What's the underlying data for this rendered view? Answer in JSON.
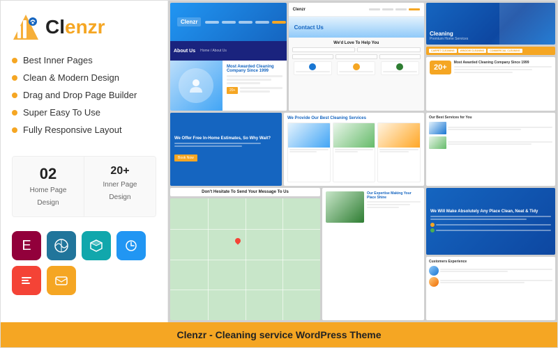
{
  "app": {
    "title": "Clenzr - Cleaning service WordPress Theme"
  },
  "logo": {
    "text_part1": "Cl",
    "text_part2": "enzr",
    "full": "Clenzr"
  },
  "features": [
    "Best Inner Pages",
    "Clean & Modern Design",
    "Drag and Drop Page Builder",
    "Super Easy To Use",
    "Fully Responsive Layout"
  ],
  "stats": [
    {
      "number": "02",
      "label1": "Home Page",
      "label2": "Design"
    },
    {
      "number": "20+",
      "label1": "Inner Page",
      "label2": "Design"
    }
  ],
  "icons": [
    {
      "name": "elementor",
      "symbol": "E",
      "class": "icon-elementor"
    },
    {
      "name": "wordpress",
      "symbol": "W",
      "class": "icon-wp"
    },
    {
      "name": "codepen",
      "symbol": "◆",
      "class": "icon-box"
    },
    {
      "name": "update",
      "symbol": "↺",
      "class": "icon-update"
    },
    {
      "name": "elementorkit",
      "symbol": "≡",
      "class": "icon-ek"
    },
    {
      "name": "mailchimp",
      "symbol": "✉",
      "class": "icon-mail"
    }
  ],
  "previews": {
    "about_us": "About Us",
    "contact_us": "Contact Us",
    "help_title": "We'd Love To Help You",
    "provide_title": "We Provide Our Best Cleaning Services",
    "free_estimate": "We Offer Free In-Home Estimates, So Why Wait?",
    "dont_hesitate": "Don't Hesitate To Send Your Message To Us",
    "expertise_title": "Our Expertise Making Your Place Shine",
    "awarded_title": "Most Awarded Cleaning Company Since 1999",
    "awarded_number": "20+",
    "best_services": "Our Best Services for You",
    "customers": "Customers Experience",
    "make_absolutely": "We Will Make Absolutely Any Place Clean, Neat & Tidy",
    "cleaning_label": "Cleaning",
    "categories": [
      "CARPET CLEANING",
      "WINDOW CLEANING",
      "COMMERCIAL CLEANING"
    ]
  },
  "footer": {
    "text": "Clenzr - Cleaning service WordPress Theme"
  }
}
